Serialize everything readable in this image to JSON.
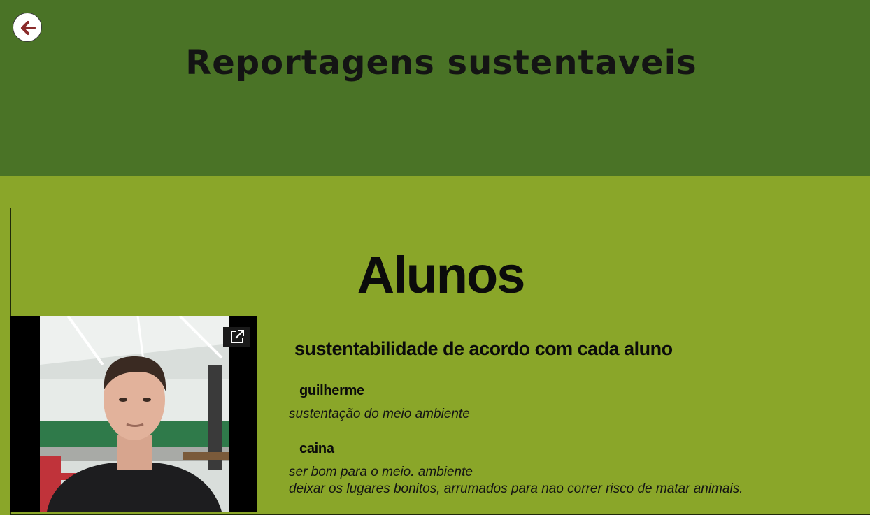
{
  "header": {
    "back_icon": "arrow-left-icon",
    "title": "Reportagens sustentaveis",
    "background_color": "#4a7326"
  },
  "main": {
    "background_color": "#8aa629",
    "section_title": "Alunos",
    "video": {
      "open_icon": "external-link-icon"
    },
    "subtitle": "sustentabilidade de acordo com cada aluno",
    "students": [
      {
        "name": "guilherme",
        "lines": [
          "sustentação do meio ambiente"
        ]
      },
      {
        "name": "caina",
        "lines": [
          "ser bom para o meio. ambiente",
          "deixar os lugares bonitos, arrumados para nao correr risco de matar animais."
        ]
      }
    ]
  }
}
